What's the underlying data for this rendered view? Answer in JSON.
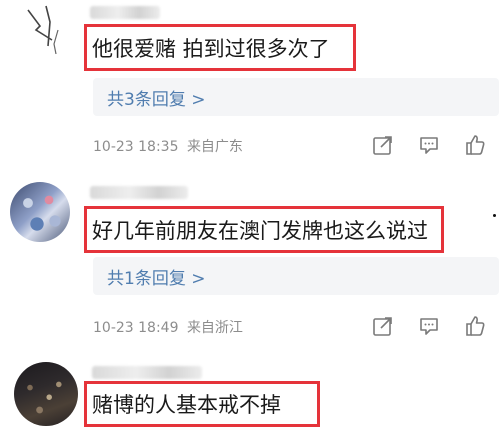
{
  "comments": [
    {
      "text": "他很爱赌  拍到过很多次了",
      "replies_label": "共3条回复 >",
      "time": "10-23 18:35",
      "location": "来自广东"
    },
    {
      "text": "好几年前朋友在澳门发牌也这么说过",
      "replies_label": "共1条回复 >",
      "time": "10-23 18:49",
      "location": "来自浙江"
    },
    {
      "text": "赌博的人基本戒不掉"
    }
  ],
  "icons": {
    "share": "share-icon",
    "comment": "comment-icon",
    "like": "thumbs-up-icon"
  },
  "colors": {
    "highlight_border": "#e5333a",
    "link": "#507daf",
    "meta": "#8d8d8d"
  }
}
